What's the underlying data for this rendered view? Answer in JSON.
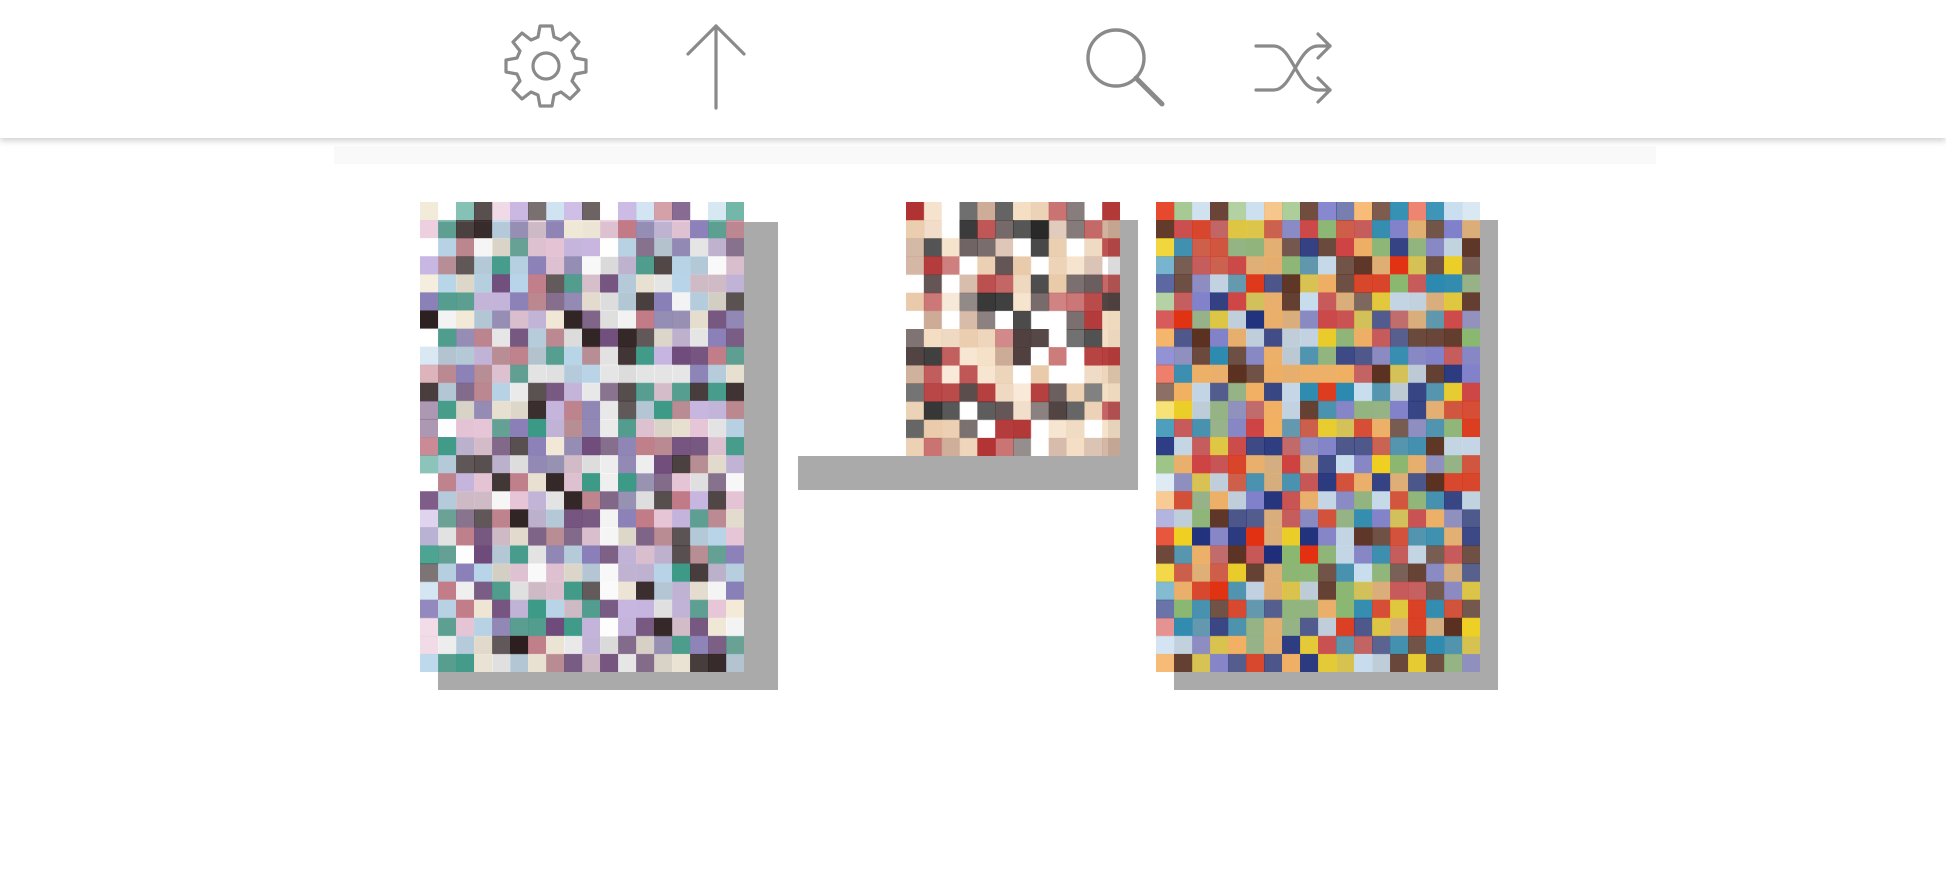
{
  "toolbar": {
    "icons": [
      "gear-icon",
      "arrow-up-icon",
      "search-icon",
      "shuffle-icon"
    ],
    "icon_color": "#888888"
  },
  "gallery": {
    "items": [
      {
        "caption_line1": "",
        "caption_line2": "",
        "art_palette": [
          "#ffffff",
          "#c8b6e2",
          "#8a7fb8",
          "#2b1d1d",
          "#b9d6ea",
          "#c27a86",
          "#e8c6d8",
          "#6e4a7a",
          "#f3ead8",
          "#3a9a86"
        ]
      },
      {
        "caption_line1": "",
        "caption_line2": "",
        "art_palette": [
          "#1e1e1e",
          "#f3dcc0",
          "#e8c8a6",
          "#4a3a3a",
          "#ffffff",
          "#b03030",
          "#c9a58e"
        ]
      },
      {
        "caption_line1": "",
        "caption_line2": "",
        "art_palette": [
          "#7f7fcc",
          "#e23010",
          "#1a2a7a",
          "#f0d020",
          "#2a8ab0",
          "#f4b060",
          "#8ab870",
          "#d04040",
          "#c8ddee",
          "#5a3020"
        ]
      }
    ]
  }
}
